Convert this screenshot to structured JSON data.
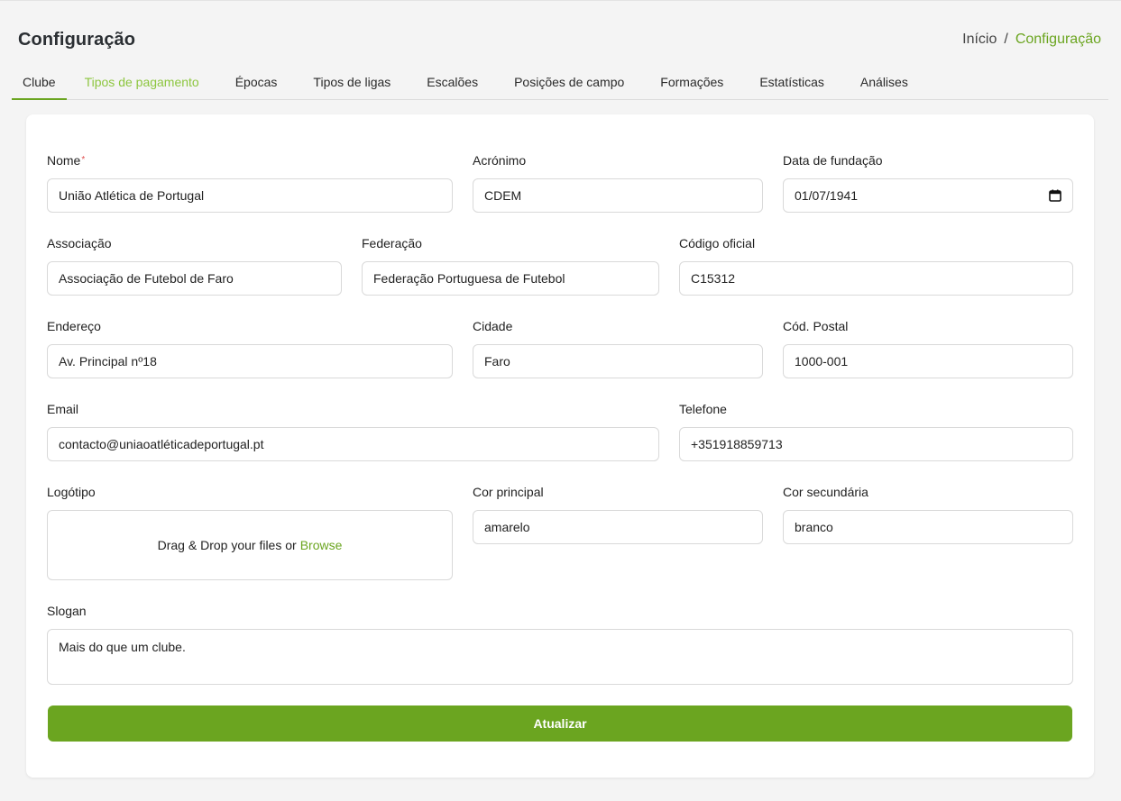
{
  "header": {
    "title": "Configuração",
    "breadcrumb": {
      "home": "Início",
      "separator": "/",
      "current": "Configuração"
    }
  },
  "tabs": [
    {
      "label": "Clube",
      "state": "active"
    },
    {
      "label": "Tipos de pagamento",
      "state": "hover"
    },
    {
      "label": "Épocas"
    },
    {
      "label": "Tipos de ligas"
    },
    {
      "label": "Escalões"
    },
    {
      "label": "Posições de campo"
    },
    {
      "label": "Formações"
    },
    {
      "label": "Estatísticas"
    },
    {
      "label": "Análises"
    }
  ],
  "form": {
    "nome": {
      "label": "Nome",
      "required_mark": "*",
      "value": "União Atlética de Portugal"
    },
    "acronimo": {
      "label": "Acrónimo",
      "value": "CDEM"
    },
    "data_fundacao": {
      "label": "Data de fundação",
      "value": "01/07/1941",
      "icon": "calendar-icon"
    },
    "associacao": {
      "label": "Associação",
      "value": "Associação de Futebol de Faro"
    },
    "federacao": {
      "label": "Federação",
      "value": "Federação Portuguesa de Futebol"
    },
    "codigo_oficial": {
      "label": "Código oficial",
      "value": "C15312"
    },
    "endereco": {
      "label": "Endereço",
      "value": "Av. Principal nº18"
    },
    "cidade": {
      "label": "Cidade",
      "value": "Faro"
    },
    "cod_postal": {
      "label": "Cód. Postal",
      "value": "1000-001"
    },
    "email": {
      "label": "Email",
      "value": "contacto@uniaoatléticadeportugal.pt"
    },
    "telefone": {
      "label": "Telefone",
      "value": "+351918859713"
    },
    "logotipo": {
      "label": "Logótipo",
      "drop_text": "Drag & Drop your files or",
      "browse_label": "Browse"
    },
    "cor_principal": {
      "label": "Cor principal",
      "value": "amarelo"
    },
    "cor_secundaria": {
      "label": "Cor secundária",
      "value": "branco"
    },
    "slogan": {
      "label": "Slogan",
      "value": "Mais do que um clube."
    },
    "submit_label": "Atualizar"
  },
  "colors": {
    "accent": "#6ba520",
    "hover_tab": "#8dc63f",
    "background": "#f4f4f4"
  }
}
